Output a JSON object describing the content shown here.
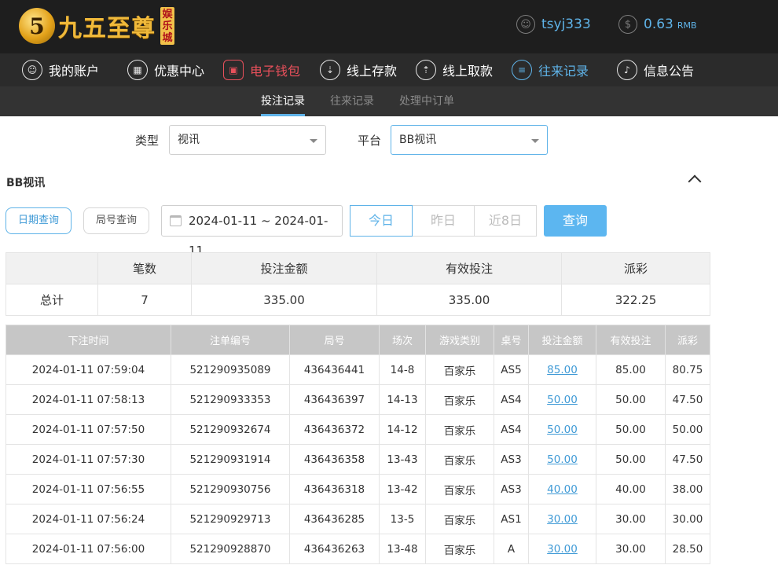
{
  "header": {
    "logo_mark": "5",
    "logo_text": "九五至尊",
    "logo_tag": [
      "娱",
      "乐",
      "城"
    ],
    "username": "tsyj333",
    "balance": "0.63",
    "currency": "RMB",
    "icons": {
      "user": "user-icon",
      "balance": "dollar-icon"
    }
  },
  "nav": {
    "items": [
      {
        "label": "我的账户",
        "icon": "user-icon",
        "glyph": "☺"
      },
      {
        "label": "优惠中心",
        "icon": "gift-icon",
        "glyph": "▦"
      },
      {
        "label": "电子钱包",
        "icon": "wallet-icon",
        "glyph": "▣"
      },
      {
        "label": "线上存款",
        "icon": "deposit-icon",
        "glyph": "⇣"
      },
      {
        "label": "线上取款",
        "icon": "withdraw-icon",
        "glyph": "⇡"
      },
      {
        "label": "往来记录",
        "icon": "records-icon",
        "glyph": "≡"
      },
      {
        "label": "信息公告",
        "icon": "bell-icon",
        "glyph": "♪"
      }
    ],
    "accent_red": "#e8505b",
    "accent_blue": "#5fb3e8"
  },
  "subnav": {
    "tabs": [
      "投注记录",
      "往来记录",
      "处理中订单"
    ],
    "active": "投注记录"
  },
  "filters": {
    "type_label": "类型",
    "type_value": "视讯",
    "platform_label": "平台",
    "platform_value": "BB视讯"
  },
  "section": {
    "title": "BB视讯"
  },
  "search": {
    "mode_date": "日期查询",
    "mode_round": "局号查询",
    "date_range": "2024-01-11 ~ 2024-01-11",
    "quick": [
      "今日",
      "昨日",
      "近8日"
    ],
    "button": "查询"
  },
  "summary": {
    "headers": [
      "",
      "笔数",
      "投注金额",
      "有效投注",
      "派彩"
    ],
    "row": [
      "总计",
      "7",
      "335.00",
      "335.00",
      "322.25"
    ]
  },
  "detail": {
    "headers": [
      "下注时间",
      "注单编号",
      "局号",
      "场次",
      "游戏类别",
      "桌号",
      "投注金额",
      "有效投注",
      "派彩"
    ],
    "rows": [
      [
        "2024-01-11 07:59:04",
        "521290935089",
        "436436441",
        "14-8",
        "百家乐",
        "AS5",
        "85.00",
        "85.00",
        "80.75"
      ],
      [
        "2024-01-11 07:58:13",
        "521290933353",
        "436436397",
        "14-13",
        "百家乐",
        "AS4",
        "50.00",
        "50.00",
        "47.50"
      ],
      [
        "2024-01-11 07:57:50",
        "521290932674",
        "436436372",
        "14-12",
        "百家乐",
        "AS4",
        "50.00",
        "50.00",
        "50.00"
      ],
      [
        "2024-01-11 07:57:30",
        "521290931914",
        "436436358",
        "13-43",
        "百家乐",
        "AS3",
        "50.00",
        "50.00",
        "47.50"
      ],
      [
        "2024-01-11 07:56:55",
        "521290930756",
        "436436318",
        "13-42",
        "百家乐",
        "AS3",
        "40.00",
        "40.00",
        "38.00"
      ],
      [
        "2024-01-11 07:56:24",
        "521290929713",
        "436436285",
        "13-5",
        "百家乐",
        "AS1",
        "30.00",
        "30.00",
        "30.00"
      ],
      [
        "2024-01-11 07:56:00",
        "521290928870",
        "436436263",
        "13-48",
        "百家乐",
        "A",
        "30.00",
        "30.00",
        "28.50"
      ]
    ]
  }
}
